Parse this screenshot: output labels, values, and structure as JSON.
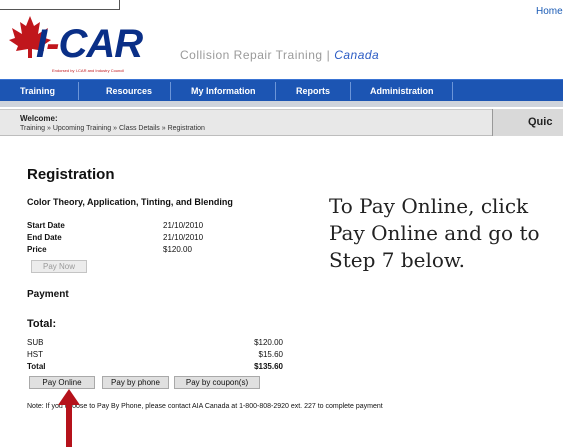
{
  "header": {
    "home_link": "Home",
    "logo_text_i": "I",
    "logo_text_dash": "-",
    "logo_text_car": "CAR",
    "logo_tagline": "Endorsed by I-CAR and Industry Council",
    "tagline": "Collision Repair Training",
    "tagline_separator": "|",
    "tagline_country": "Canada"
  },
  "nav": {
    "items": [
      "Training",
      "Resources",
      "My Information",
      "Reports",
      "Administration"
    ]
  },
  "welcome": {
    "label": "Welcome:",
    "breadcrumb": "Training » Upcoming Training » Class Details » Registration",
    "quick_label": "Quic"
  },
  "registration": {
    "title": "Registration",
    "class_name": "Color Theory, Application, Tinting, and Blending",
    "details": [
      {
        "label": "Start Date",
        "value": "21/10/2010"
      },
      {
        "label": "End Date",
        "value": "21/10/2010"
      },
      {
        "label": "Price",
        "value": "$120.00"
      }
    ],
    "pay_now_label": "Pay Now"
  },
  "payment": {
    "heading": "Payment",
    "total_heading": "Total:",
    "summary": [
      {
        "label": "SUB",
        "value": "$120.00"
      },
      {
        "label": "HST",
        "value": "$15.60"
      },
      {
        "label": "Total",
        "value": "$135.60"
      }
    ],
    "buttons": [
      "Pay Online",
      "Pay by phone",
      "Pay by coupon(s)"
    ],
    "note": "Note: If you choose to Pay By Phone, please contact AIA Canada at 1-800-808-2920 ext. 227 to complete payment"
  },
  "instruction": {
    "text": "To Pay Online, click Pay Online and go to Step 7 below."
  },
  "colors": {
    "nav_blue": "#1c55b3",
    "logo_blue": "#0a2f87",
    "logo_red": "#c0161c",
    "arrow_red": "#b5121b"
  }
}
